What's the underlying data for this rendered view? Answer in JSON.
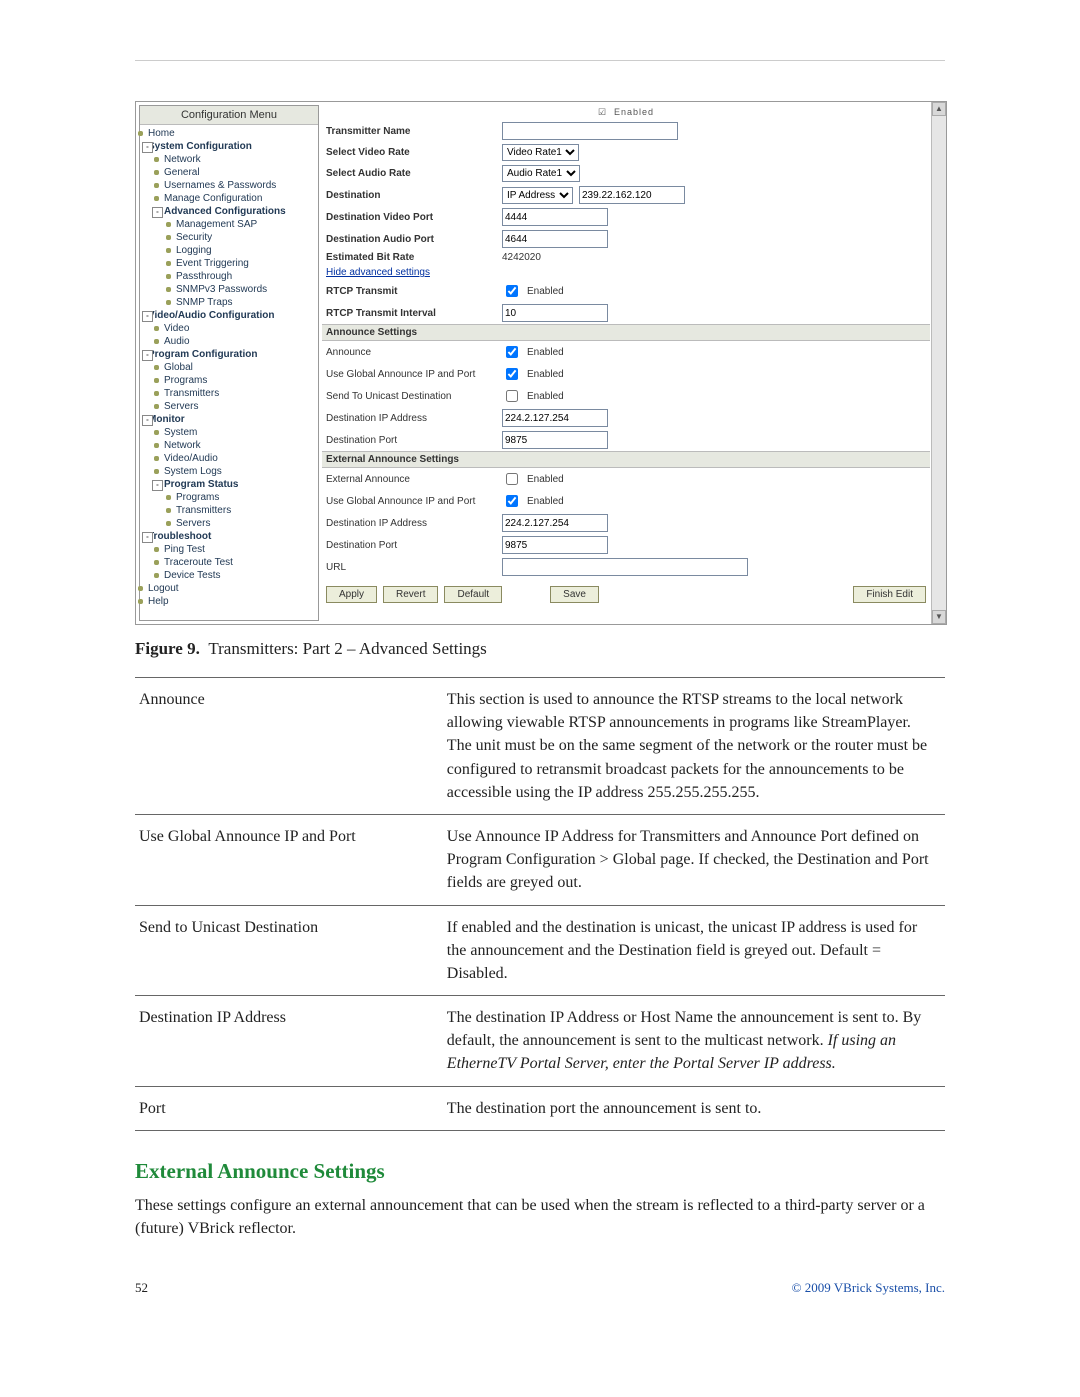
{
  "sidebar": {
    "title": "Configuration Menu",
    "items": [
      {
        "label": "Home",
        "lvl": 1,
        "dot": true
      },
      {
        "label": "System Configuration",
        "lvl": 1,
        "bold": true,
        "sq": "-"
      },
      {
        "label": "Network",
        "lvl": 2,
        "dot": true
      },
      {
        "label": "General",
        "lvl": 2,
        "dot": true
      },
      {
        "label": "Usernames & Passwords",
        "lvl": 2,
        "dot": true
      },
      {
        "label": "Manage Configuration",
        "lvl": 2,
        "dot": true
      },
      {
        "label": "Advanced Configurations",
        "lvl": 2,
        "bold": true,
        "sq": "-"
      },
      {
        "label": "Management SAP",
        "lvl": 3,
        "dot": true
      },
      {
        "label": "Security",
        "lvl": 3,
        "dot": true
      },
      {
        "label": "Logging",
        "lvl": 3,
        "dot": true
      },
      {
        "label": "Event Triggering",
        "lvl": 3,
        "dot": true
      },
      {
        "label": "Passthrough",
        "lvl": 3,
        "dot": true
      },
      {
        "label": "SNMPv3 Passwords",
        "lvl": 3,
        "dot": true
      },
      {
        "label": "SNMP Traps",
        "lvl": 3,
        "dot": true
      },
      {
        "label": "Video/Audio Configuration",
        "lvl": 1,
        "bold": true,
        "sq": "-"
      },
      {
        "label": "Video",
        "lvl": 2,
        "dot": true
      },
      {
        "label": "Audio",
        "lvl": 2,
        "dot": true
      },
      {
        "label": "Program Configuration",
        "lvl": 1,
        "bold": true,
        "sq": "-"
      },
      {
        "label": "Global",
        "lvl": 2,
        "dot": true
      },
      {
        "label": "Programs",
        "lvl": 2,
        "dot": true
      },
      {
        "label": "Transmitters",
        "lvl": 2,
        "dot": true
      },
      {
        "label": "Servers",
        "lvl": 2,
        "dot": true
      },
      {
        "label": "Monitor",
        "lvl": 1,
        "bold": true,
        "sq": "-"
      },
      {
        "label": "System",
        "lvl": 2,
        "dot": true
      },
      {
        "label": "Network",
        "lvl": 2,
        "dot": true
      },
      {
        "label": "Video/Audio",
        "lvl": 2,
        "dot": true
      },
      {
        "label": "System Logs",
        "lvl": 2,
        "dot": true
      },
      {
        "label": "Program Status",
        "lvl": 2,
        "bold": true,
        "sq": "-"
      },
      {
        "label": "Programs",
        "lvl": 3,
        "dot": true
      },
      {
        "label": "Transmitters",
        "lvl": 3,
        "dot": true
      },
      {
        "label": "Servers",
        "lvl": 3,
        "dot": true
      },
      {
        "label": "Troubleshoot",
        "lvl": 1,
        "bold": true,
        "sq": "-"
      },
      {
        "label": "Ping Test",
        "lvl": 2,
        "dot": true
      },
      {
        "label": "Traceroute Test",
        "lvl": 2,
        "dot": true
      },
      {
        "label": "Device Tests",
        "lvl": 2,
        "dot": true
      },
      {
        "label": "Logout",
        "lvl": 1,
        "dot": true
      },
      {
        "label": "Help",
        "lvl": 1,
        "dot": true
      }
    ]
  },
  "form": {
    "cutoff": "Enabled",
    "transmitter_name_lab": "Transmitter Name",
    "select_video_rate_lab": "Select Video Rate",
    "select_video_rate_val": "Video Rate1",
    "select_audio_rate_lab": "Select Audio Rate",
    "select_audio_rate_val": "Audio Rate1",
    "destination_lab": "Destination",
    "destination_type": "IP Address",
    "destination_val": "239.22.162.120",
    "dest_video_port_lab": "Destination Video Port",
    "dest_video_port_val": "4444",
    "dest_audio_port_lab": "Destination Audio Port",
    "dest_audio_port_val": "4644",
    "est_bitrate_lab": "Estimated Bit Rate",
    "est_bitrate_val": "4242020",
    "hide_adv_lab": "Hide advanced settings",
    "rtcp_transmit_lab": "RTCP Transmit",
    "rtcp_transmit_en": "Enabled",
    "rtcp_interval_lab": "RTCP Transmit Interval",
    "rtcp_interval_val": "10",
    "announce_section": "Announce Settings",
    "announce_lab": "Announce",
    "announce_en": "Enabled",
    "use_global_lab": "Use Global Announce IP and Port",
    "use_global_en": "Enabled",
    "send_unicast_lab": "Send To Unicast Destination",
    "send_unicast_en": "Enabled",
    "dest_ip_lab": "Destination IP Address",
    "dest_ip_val": "224.2.127.254",
    "dest_port_lab": "Destination Port",
    "dest_port_val": "9875",
    "ext_section": "External Announce Settings",
    "ext_announce_lab": "External Announce",
    "ext_announce_en": "Enabled",
    "ext_use_global_lab": "Use Global Announce IP and Port",
    "ext_use_global_en": "Enabled",
    "ext_dest_ip_lab": "Destination IP Address",
    "ext_dest_ip_val": "224.2.127.254",
    "ext_dest_port_lab": "Destination Port",
    "ext_dest_port_val": "9875",
    "url_lab": "URL",
    "url_val": ""
  },
  "buttons": {
    "apply": "Apply",
    "revert": "Revert",
    "default": "Default",
    "save": "Save",
    "finish": "Finish Edit"
  },
  "figure": {
    "label": "Figure 9.",
    "caption": "Transmitters: Part 2 – Advanced Settings"
  },
  "table": [
    {
      "k": "Announce",
      "v": "This section is used to announce the RTSP streams to the local network allowing viewable RTSP announcements in programs like StreamPlayer. The unit must be on the same segment of the network or the router must be configured to retransmit broadcast packets for the announcements to be accessible using the IP address 255.255.255.255."
    },
    {
      "k": "Use Global Announce IP and Port",
      "v": "Use Announce IP Address for Transmitters and Announce Port defined on Program Configuration > Global page. If checked, the Destination and Port fields are greyed out."
    },
    {
      "k": "Send to Unicast Destination",
      "v": "If enabled and the destination is unicast, the unicast IP address is used for the announcement and the Destination field is greyed out. Default = Disabled."
    },
    {
      "k": "Destination IP Address",
      "v_html": true,
      "v": "The destination IP Address or Host Name the announcement is sent to. By default, the announcement is sent to the multicast network. <em>If using an EtherneTV Portal Server, enter the Portal Server IP address.</em>"
    },
    {
      "k": "Port",
      "v": "The destination port the announcement is sent to."
    }
  ],
  "heading": "External Announce Settings",
  "paragraph": "These settings configure an external announcement that can be used when the stream is reflected to a third-party server or a (future) VBrick reflector.",
  "footer": {
    "page": "52",
    "copyright": "© 2009 VBrick Systems, Inc."
  }
}
